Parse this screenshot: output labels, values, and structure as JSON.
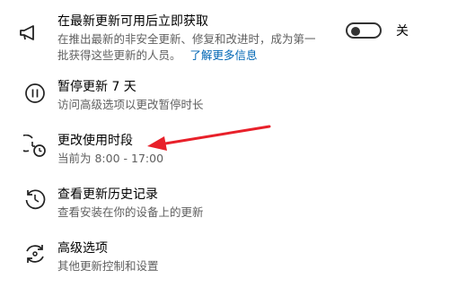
{
  "settings": {
    "items": [
      {
        "title": "在最新更新可用后立即获取",
        "description_line1": "在推出最新的非安全更新、修复和改进时，成为第一",
        "description_line2": "批获得这些更新的人员。",
        "link": "了解更多信息",
        "icon": "megaphone-icon"
      },
      {
        "title": "暂停更新 7 天",
        "description": "访问高级选项以更改暂停时长",
        "icon": "pause-icon"
      },
      {
        "title": "更改使用时段",
        "description": "当前为 8:00 - 17:00",
        "icon": "active-hours-icon"
      },
      {
        "title": "查看更新历史记录",
        "description": "查看安装在你的设备上的更新",
        "icon": "history-icon"
      },
      {
        "title": "高级选项",
        "description": "其他更新控制和设置",
        "icon": "advanced-options-icon"
      }
    ],
    "toggle": {
      "state_label": "关",
      "is_on": false
    }
  },
  "colors": {
    "link": "#0066b4",
    "arrow": "#e8202a",
    "secondary_text": "#5f5f5f"
  }
}
